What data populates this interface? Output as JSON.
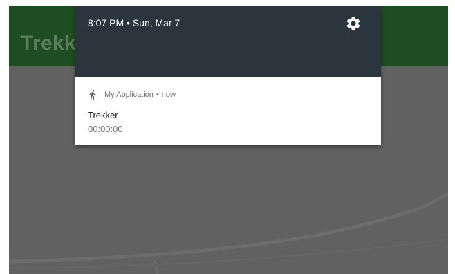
{
  "app": {
    "title": "Trekker",
    "toolbar_color": "#1f4d22"
  },
  "shade": {
    "status_time": "8:07 PM • Sun, Mar 7",
    "settings_icon": "gear-icon",
    "header_color": "#2b353e"
  },
  "notification": {
    "app_icon": "walking-person-icon",
    "app_name": "My Application",
    "separator": "•",
    "time": "now",
    "title": "Trekker",
    "text": "00:00:00"
  }
}
